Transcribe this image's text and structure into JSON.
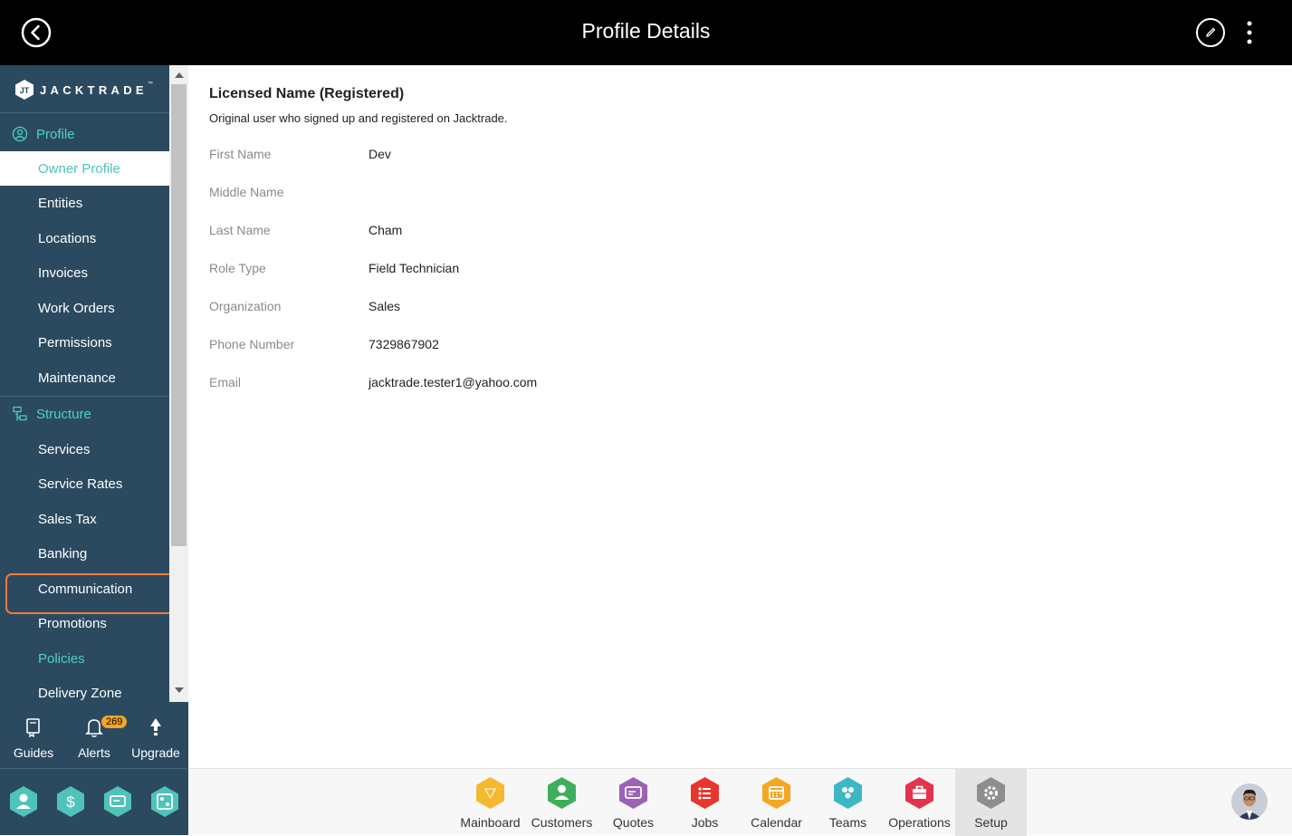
{
  "header": {
    "title": "Profile Details"
  },
  "brand": {
    "name": "JACKTRADE",
    "tm": "™"
  },
  "sidebar": {
    "sections": [
      {
        "label": "Profile",
        "items": [
          "Owner Profile",
          "Entities",
          "Locations",
          "Invoices",
          "Work Orders",
          "Permissions",
          "Maintenance"
        ]
      },
      {
        "label": "Structure",
        "items": [
          "Services",
          "Service Rates",
          "Sales Tax",
          "Banking",
          "Communication",
          "Promotions",
          "Policies",
          "Delivery Zone"
        ]
      }
    ],
    "active_item": "Owner Profile",
    "highlighted_item": "Policies"
  },
  "util": {
    "guides": "Guides",
    "alerts": "Alerts",
    "alerts_count": "269",
    "upgrade": "Upgrade"
  },
  "profile": {
    "section_title": "Licensed Name (Registered)",
    "section_desc": "Original user who signed up and registered on Jacktrade.",
    "fields": [
      {
        "label": "First Name",
        "value": "Dev"
      },
      {
        "label": "Middle Name",
        "value": ""
      },
      {
        "label": "Last Name",
        "value": "Cham"
      },
      {
        "label": "Role Type",
        "value": "Field Technician"
      },
      {
        "label": "Organization",
        "value": "Sales"
      },
      {
        "label": "Phone Number",
        "value": "7329867902"
      },
      {
        "label": "Email",
        "value": "jacktrade.tester1@yahoo.com"
      }
    ]
  },
  "bottom_nav": [
    {
      "label": "Mainboard",
      "color": "#f5b82e",
      "icon": "mainboard-icon"
    },
    {
      "label": "Customers",
      "color": "#3fae5a",
      "icon": "customers-icon"
    },
    {
      "label": "Quotes",
      "color": "#9b62b5",
      "icon": "quotes-icon"
    },
    {
      "label": "Jobs",
      "color": "#e8362d",
      "icon": "jobs-icon"
    },
    {
      "label": "Calendar",
      "color": "#f5a623",
      "icon": "calendar-icon"
    },
    {
      "label": "Teams",
      "color": "#3cb8c4",
      "icon": "teams-icon"
    },
    {
      "label": "Operations",
      "color": "#e1344f",
      "icon": "operations-icon"
    },
    {
      "label": "Setup",
      "color": "#8e8e8e",
      "icon": "setup-icon",
      "active": true
    }
  ],
  "colors": {
    "sidebar_bg": "#2b4a5f",
    "accent": "#4fd1c6",
    "highlight": "#f07a3c"
  }
}
